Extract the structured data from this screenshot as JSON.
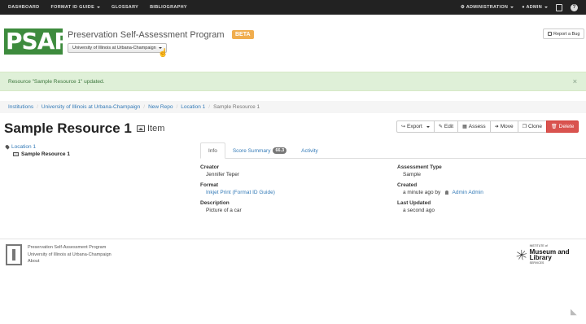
{
  "nav": {
    "left": [
      "DASHBOARD",
      "FORMAT ID GUIDE",
      "GLOSSARY",
      "BIBLIOGRAPHY"
    ],
    "admin_menu": "ADMINISTRATION",
    "user_menu": "ADMIN",
    "help": "?"
  },
  "header": {
    "logo_text": "PSAP",
    "app_title": "Preservation Self-Assessment Program",
    "beta_badge": "BETA",
    "institution_selector": "University of Illinois at Urbana-Champaign",
    "report_bug": "Report a Bug"
  },
  "alert": {
    "message": "Resource \"Sample Resource 1\" updated.",
    "close": "×"
  },
  "breadcrumb": [
    "Institutions",
    "University of Illinois at Urbana-Champaign",
    "New Repo",
    "Location 1",
    "Sample Resource 1"
  ],
  "page": {
    "title": "Sample Resource 1",
    "type": "Item"
  },
  "actions": {
    "export": "Export",
    "edit": "Edit",
    "assess": "Assess",
    "move": "Move",
    "clone": "Clone",
    "delete": "Delete"
  },
  "tree": {
    "location": "Location 1",
    "resource": "Sample Resource 1"
  },
  "tabs": {
    "info": "Info",
    "score_summary": "Score Summary",
    "score_value": "66.3",
    "activity": "Activity"
  },
  "info": {
    "creator_label": "Creator",
    "creator_value": "Jennifer Teper",
    "format_label": "Format",
    "format_value": "Inkjet Print (Format ID Guide)",
    "description_label": "Description",
    "description_value": "Picture of a car",
    "assessment_type_label": "Assessment Type",
    "assessment_type_value": "Sample",
    "created_label": "Created",
    "created_value": "a minute ago by",
    "created_by": "Admin Admin",
    "last_updated_label": "Last Updated",
    "last_updated_value": "a second ago"
  },
  "footer": {
    "line1": "Preservation Self-Assessment Program",
    "line2": "University of Illinois at Urbana-Champaign",
    "about": "About",
    "imls_top": "INSTITUTE of",
    "imls_main": "Museum and Library",
    "imls_bottom": "SERVICES"
  }
}
